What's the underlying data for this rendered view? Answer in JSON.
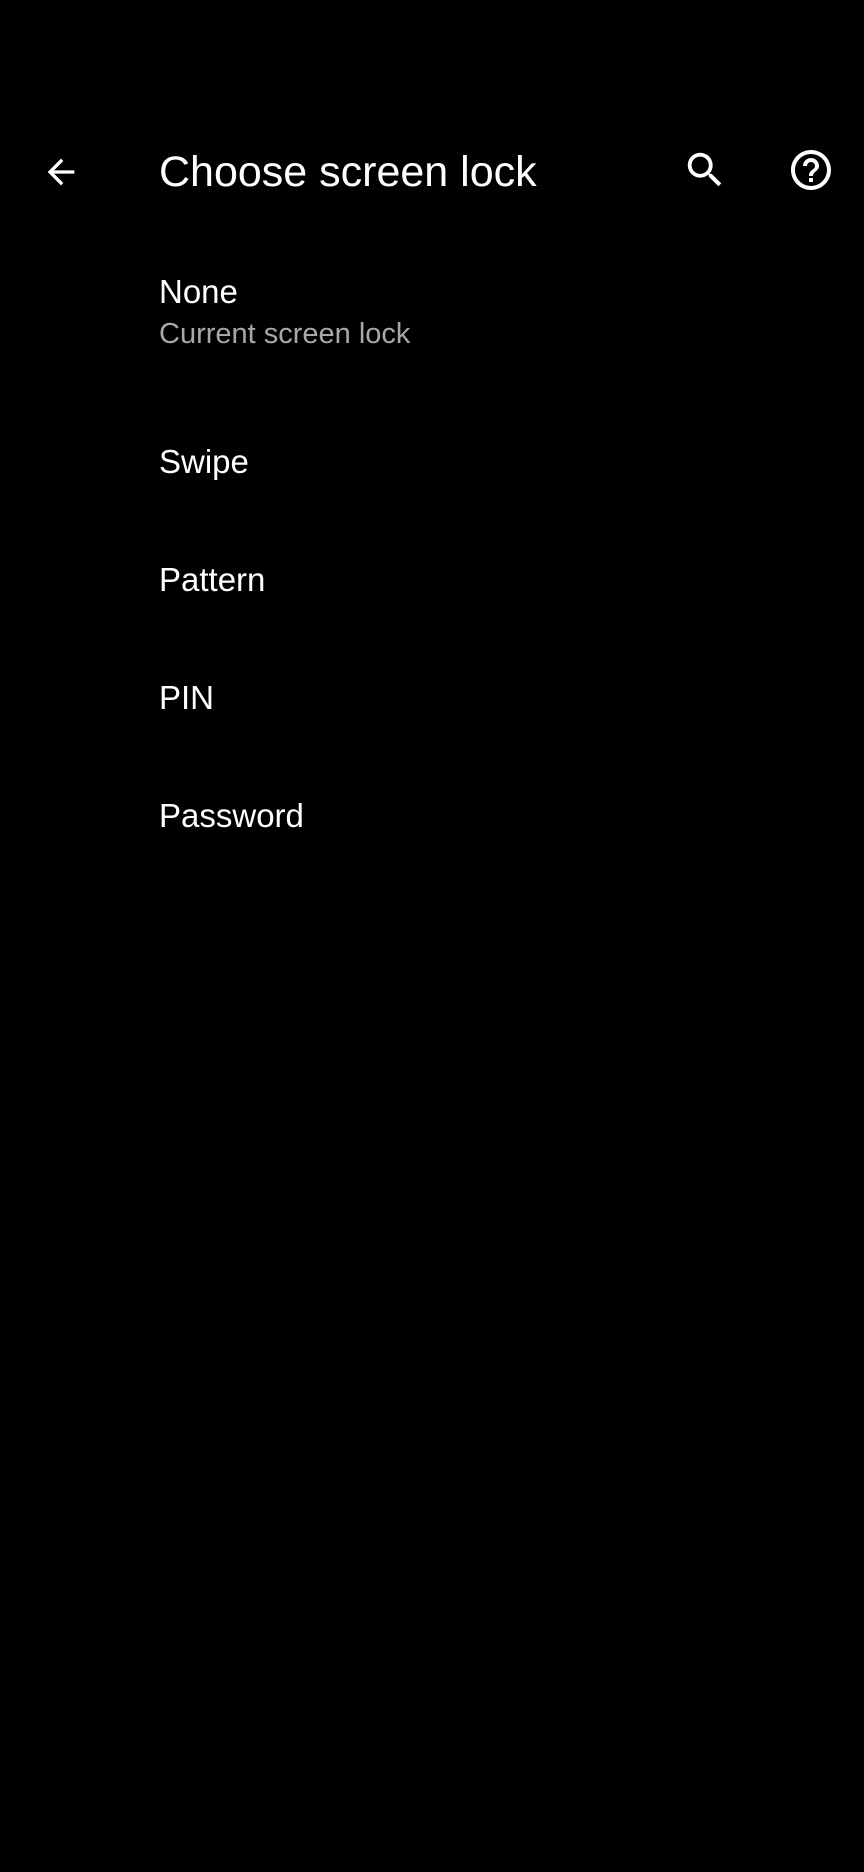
{
  "header": {
    "title": "Choose screen lock",
    "back_icon": "arrow-back-icon",
    "search_icon": "search-icon",
    "help_icon": "help-circle-icon"
  },
  "options": [
    {
      "title": "None",
      "summary": "Current screen lock"
    },
    {
      "title": "Swipe"
    },
    {
      "title": "Pattern"
    },
    {
      "title": "PIN"
    },
    {
      "title": "Password"
    }
  ],
  "colors": {
    "background": "#000000",
    "primary_text": "#ffffff",
    "secondary_text": "#a8a8a8"
  }
}
